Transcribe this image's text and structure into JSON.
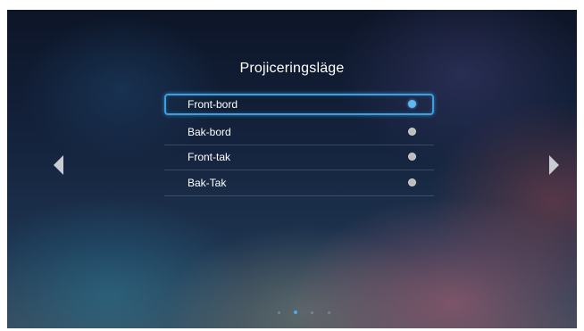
{
  "menu": {
    "title": "Projiceringsläge",
    "selected_index": 0,
    "options": [
      {
        "label": "Front-bord",
        "selected": true
      },
      {
        "label": "Bak-bord",
        "selected": false
      },
      {
        "label": "Front-tak",
        "selected": false
      },
      {
        "label": "Bak-Tak",
        "selected": false
      }
    ]
  },
  "navigation": {
    "left_icon": "arrow-left-icon",
    "right_icon": "arrow-right-icon"
  },
  "pager": {
    "page_count": 4,
    "active_page": 2
  },
  "colors": {
    "accent": "#3aa0e0",
    "text": "#ffffff",
    "radio_unselected": "#bdbdbd"
  }
}
